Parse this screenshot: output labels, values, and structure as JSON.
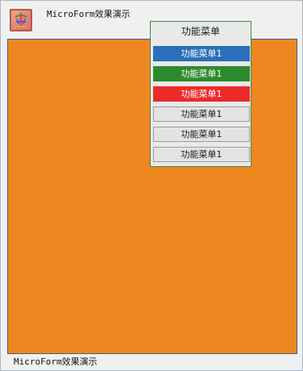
{
  "window": {
    "title": "MicroForm效果演示",
    "icon": "app-logo-icon"
  },
  "content": {
    "background_color": "#ef8721"
  },
  "menu": {
    "header": "功能菜单",
    "items": [
      {
        "label": "功能菜单1",
        "bg": "#2a6fb9",
        "fg": "#ffffff"
      },
      {
        "label": "功能菜单1",
        "bg": "#2c8a2c",
        "fg": "#ffffff"
      },
      {
        "label": "功能菜单1",
        "bg": "#ec2a2a",
        "fg": "#ffffff"
      },
      {
        "label": "功能菜单1",
        "bg": "#e3e3e3",
        "fg": "#1a1a1a"
      },
      {
        "label": "功能菜单1",
        "bg": "#e3e3e3",
        "fg": "#1a1a1a"
      },
      {
        "label": "功能菜单1",
        "bg": "#e3e3e3",
        "fg": "#1a1a1a"
      }
    ]
  },
  "status": {
    "text": "MicroForm效果演示"
  }
}
